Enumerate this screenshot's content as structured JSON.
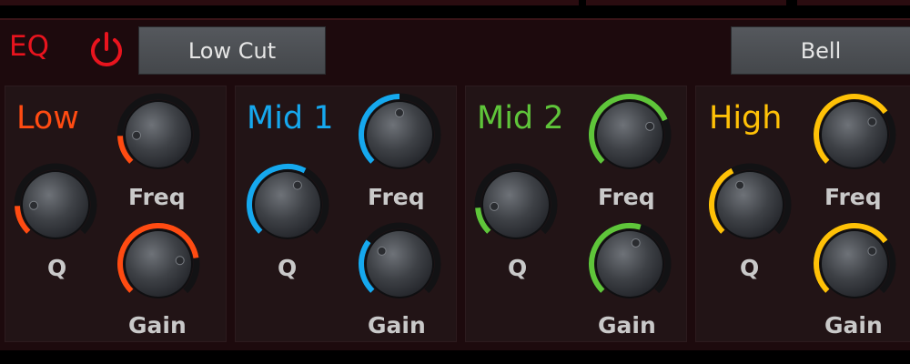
{
  "header": {
    "title": "EQ",
    "power_icon": "power-icon",
    "low_cut_label": "Low Cut",
    "bell_label": "Bell"
  },
  "colors": {
    "eq_red": "#e8141e",
    "low": "#ff4b12",
    "mid1": "#16a8ee",
    "mid2": "#5fc53a",
    "high": "#ffc107"
  },
  "bands": [
    {
      "name": "Low",
      "freq_label": "Freq",
      "q_label": "Q",
      "gain_label": "Gain",
      "freq": 0.16,
      "q": 0.16,
      "gain": 0.8
    },
    {
      "name": "Mid 1",
      "freq_label": "Freq",
      "q_label": "Q",
      "gain_label": "Gain",
      "freq": 0.5,
      "q": 0.6,
      "gain": 0.3
    },
    {
      "name": "Mid 2",
      "freq_label": "Freq",
      "q_label": "Q",
      "gain_label": "Gain",
      "freq": 0.75,
      "q": 0.15,
      "gain": 0.56
    },
    {
      "name": "High",
      "freq_label": "Freq",
      "q_label": "Q",
      "gain_label": "Gain",
      "freq": 0.7,
      "q": 0.4,
      "gain": 0.7
    }
  ]
}
